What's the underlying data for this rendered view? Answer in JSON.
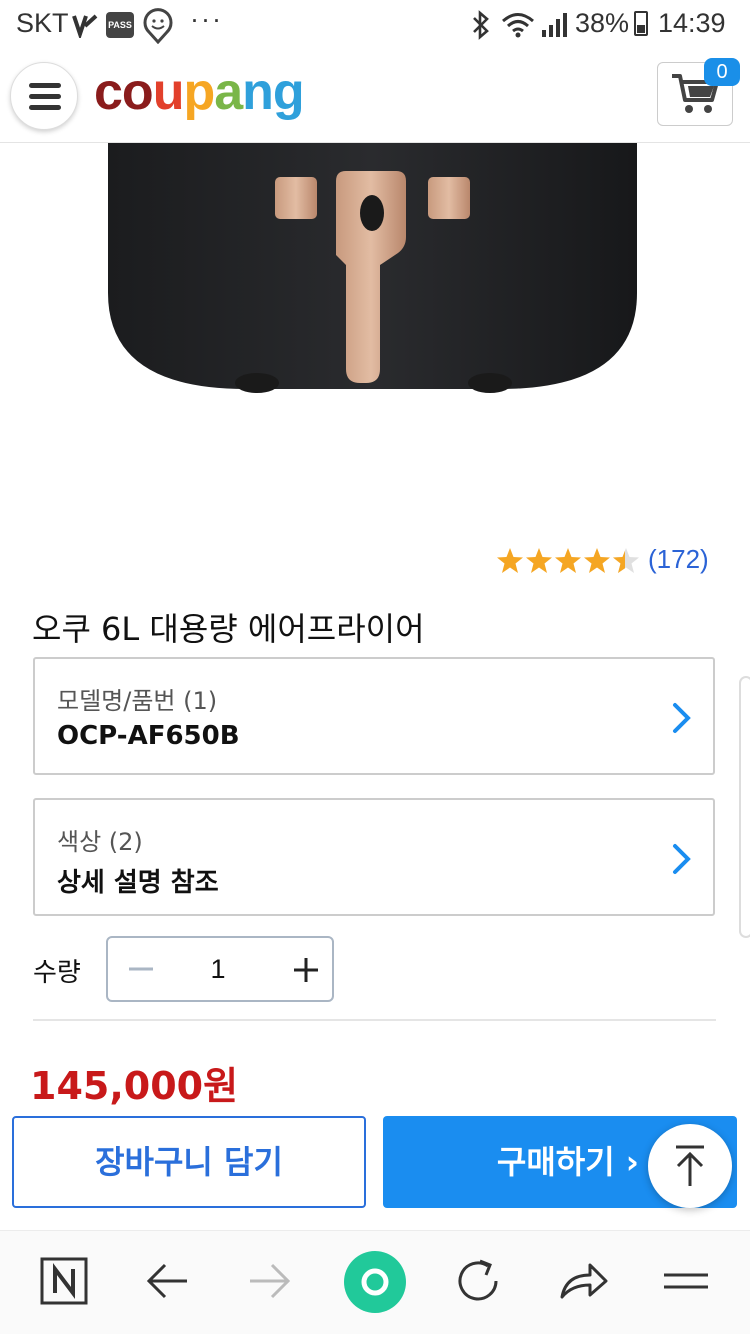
{
  "status_bar": {
    "carrier": "SKT",
    "pass_label": "PASS",
    "dots": "···",
    "battery": "38%",
    "time": "14:39"
  },
  "header": {
    "logo_letters": [
      {
        "ch": "c",
        "color": "#8a1c1c"
      },
      {
        "ch": "o",
        "color": "#8a1c1c"
      },
      {
        "ch": "u",
        "color": "#e2402b"
      },
      {
        "ch": "p",
        "color": "#f6a623"
      },
      {
        "ch": "a",
        "color": "#7ab648"
      },
      {
        "ch": "n",
        "color": "#2fa0db"
      },
      {
        "ch": "g",
        "color": "#2fa0db"
      }
    ],
    "cart_count": "0"
  },
  "product": {
    "rating_stars": 4.5,
    "review_count": "(172)",
    "title": "오쿠 6L 대용량 에어프라이어",
    "options": [
      {
        "label": "모델명/품번 (1)",
        "value": "OCP-AF650B"
      },
      {
        "label": "색상 (2)",
        "value": "상세 설명 참조"
      }
    ],
    "quantity_label": "수량",
    "quantity": "1",
    "price": "145,000원"
  },
  "actions": {
    "add_to_cart": "장바구니 담기",
    "buy_now": "구매하기 ›"
  },
  "colors": {
    "accent_blue": "#1a8df0",
    "price_red": "#c8191a",
    "star_gold": "#f5a623",
    "link_blue": "#2b63d6"
  },
  "bottom_bar": {
    "icons": [
      "naver-n-icon",
      "back-arrow-icon",
      "forward-arrow-icon",
      "home-circle-icon",
      "refresh-icon",
      "share-icon",
      "menu-icon"
    ]
  }
}
